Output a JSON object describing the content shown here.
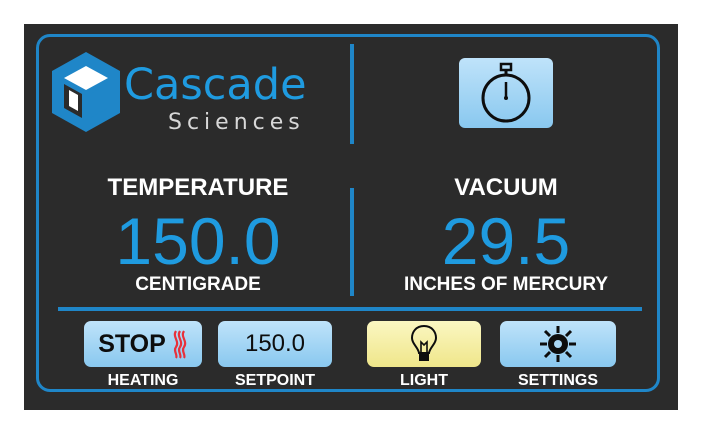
{
  "brand": {
    "name": "Cascade",
    "sub": "Sciences"
  },
  "temperature": {
    "title": "TEMPERATURE",
    "value": "150.0",
    "unit": "CENTIGRADE"
  },
  "vacuum": {
    "title": "VACUUM",
    "value": "29.5",
    "unit": "INCHES OF MERCURY"
  },
  "buttons": {
    "heating": {
      "label": "STOP",
      "caption": "HEATING"
    },
    "setpoint": {
      "label": "150.0",
      "caption": "SETPOINT"
    },
    "light": {
      "caption": "LIGHT"
    },
    "settings": {
      "caption": "SETTINGS"
    }
  },
  "colors": {
    "accent": "#1f86c8",
    "value": "#1f9be0",
    "background": "#2b2b2b",
    "button": "#a9d6f3",
    "light_button": "#f6f0a6",
    "heat": "#e8303a"
  },
  "icons": {
    "timer": "stopwatch-icon",
    "light": "lightbulb-icon",
    "settings": "sun-gear-icon",
    "heat": "heat-waves-icon",
    "logo": "cube-hexagon-icon"
  }
}
